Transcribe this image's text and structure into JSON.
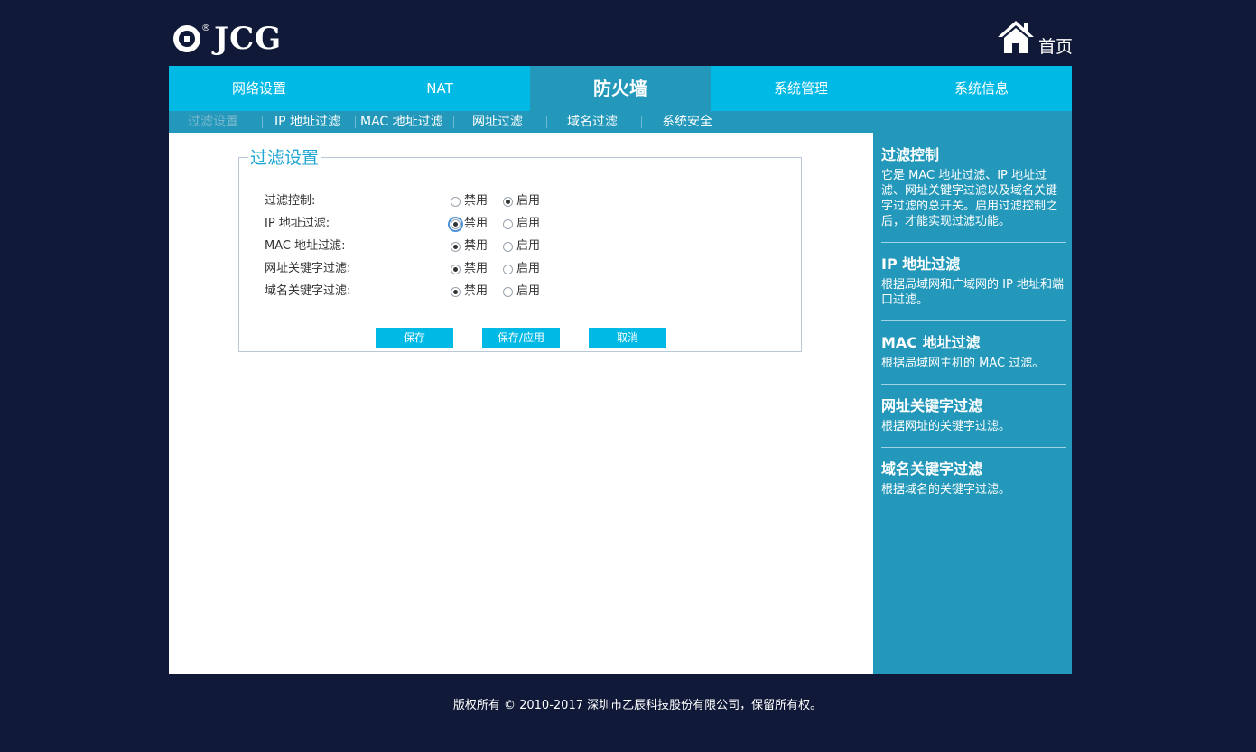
{
  "logo": {
    "text": "JCG",
    "reg_mark": "®"
  },
  "header": {
    "home_label": "首页"
  },
  "nav": {
    "tabs": [
      "网络设置",
      "NAT",
      "防火墙",
      "系统管理",
      "系统信息"
    ],
    "active_index": 2
  },
  "subnav": {
    "items": [
      "过滤设置",
      "IP 地址过滤",
      "MAC 地址过滤",
      "网址过滤",
      "域名过滤",
      "系统安全"
    ],
    "active_index": 0
  },
  "form": {
    "legend": "过滤设置",
    "option_disable": "禁用",
    "option_enable": "启用",
    "rows": [
      {
        "label": "过滤控制:",
        "value": "启用"
      },
      {
        "label": "IP 地址过滤:",
        "value": "禁用"
      },
      {
        "label": "MAC 地址过滤:",
        "value": "禁用"
      },
      {
        "label": "网址关键字过滤:",
        "value": "禁用"
      },
      {
        "label": "域名关键字过滤:",
        "value": "禁用"
      }
    ],
    "buttons": {
      "save": "保存",
      "save_apply": "保存/应用",
      "cancel": "取消"
    }
  },
  "help": [
    {
      "title": "过滤控制",
      "text": "它是 MAC 地址过滤、IP 地址过滤、网址关键字过滤以及域名关键字过滤的总开关。启用过滤控制之后，才能实现过滤功能。"
    },
    {
      "title": "IP 地址过滤",
      "text": "根据局域网和广域网的 IP 地址和端口过滤。"
    },
    {
      "title": "MAC 地址过滤",
      "text": "根据局域网主机的 MAC 过滤。"
    },
    {
      "title": "网址关键字过滤",
      "text": "根据网址的关键字过滤。"
    },
    {
      "title": "域名关键字过滤",
      "text": "根据域名的关键字过滤。"
    }
  ],
  "footer": {
    "copyright": "版权所有 © 2010-2017 深圳市乙辰科技股份有限公司，保留所有权。"
  },
  "colors": {
    "background": "#101a38",
    "nav": "#00b9e5",
    "nav_active": "#2398bb",
    "accent": "#1ea6d2"
  }
}
